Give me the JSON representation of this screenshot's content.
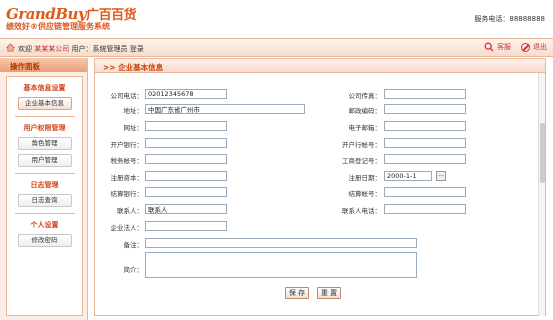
{
  "header": {
    "logo_en": "GrandBuy",
    "logo_cn": "广百百货",
    "slogan": "绩效好®供应链管理服务系统",
    "hotline": "服务电话：88888888"
  },
  "navbar": {
    "welcome": "欢迎",
    "company": "某某某公司",
    "user": "用户：系统管理员 登录",
    "service_label": "客服",
    "logout_label": "退出"
  },
  "sidebar": {
    "title": "操作面板",
    "sections": [
      {
        "title": "基本信息设置",
        "items": [
          "企业基本信息"
        ]
      },
      {
        "title": "用户权限管理",
        "items": [
          "角色管理",
          "用户管理"
        ]
      },
      {
        "title": "日志管理",
        "items": [
          "日志查询"
        ]
      },
      {
        "title": "个人设置",
        "items": [
          "修改密码"
        ]
      }
    ]
  },
  "main": {
    "title": ">> 企业基本信息",
    "fields": {
      "phone": {
        "label": "公司电话：",
        "value": "02012345678"
      },
      "fax": {
        "label": "公司传真：",
        "value": ""
      },
      "address": {
        "label": "地址：",
        "value": "中国广东省广州市"
      },
      "postcode": {
        "label": "邮政编码：",
        "value": ""
      },
      "website": {
        "label": "网址：",
        "value": ""
      },
      "email": {
        "label": "电子邮箱：",
        "value": ""
      },
      "bank": {
        "label": "开户银行：",
        "value": ""
      },
      "account": {
        "label": "开户行帐号：",
        "value": ""
      },
      "tax_no": {
        "label": "税务帐号：",
        "value": ""
      },
      "reg_no": {
        "label": "工商登记号：",
        "value": ""
      },
      "capital": {
        "label": "注册资本：",
        "value": ""
      },
      "reg_date": {
        "label": "注册日期：",
        "value": "2000-1-1"
      },
      "settle_bank": {
        "label": "结算银行：",
        "value": ""
      },
      "settle_account": {
        "label": "结算帐号：",
        "value": ""
      },
      "contact": {
        "label": "联系人：",
        "value": "联系人"
      },
      "contact_phone": {
        "label": "联系人电话：",
        "value": ""
      },
      "legal": {
        "label": "企业法人：",
        "value": ""
      },
      "remark": {
        "label": "备注：",
        "value": ""
      },
      "intro": {
        "label": "简介：",
        "value": ""
      }
    },
    "date_button": "...",
    "save_label": "保 存",
    "reset_label": "重 置"
  }
}
